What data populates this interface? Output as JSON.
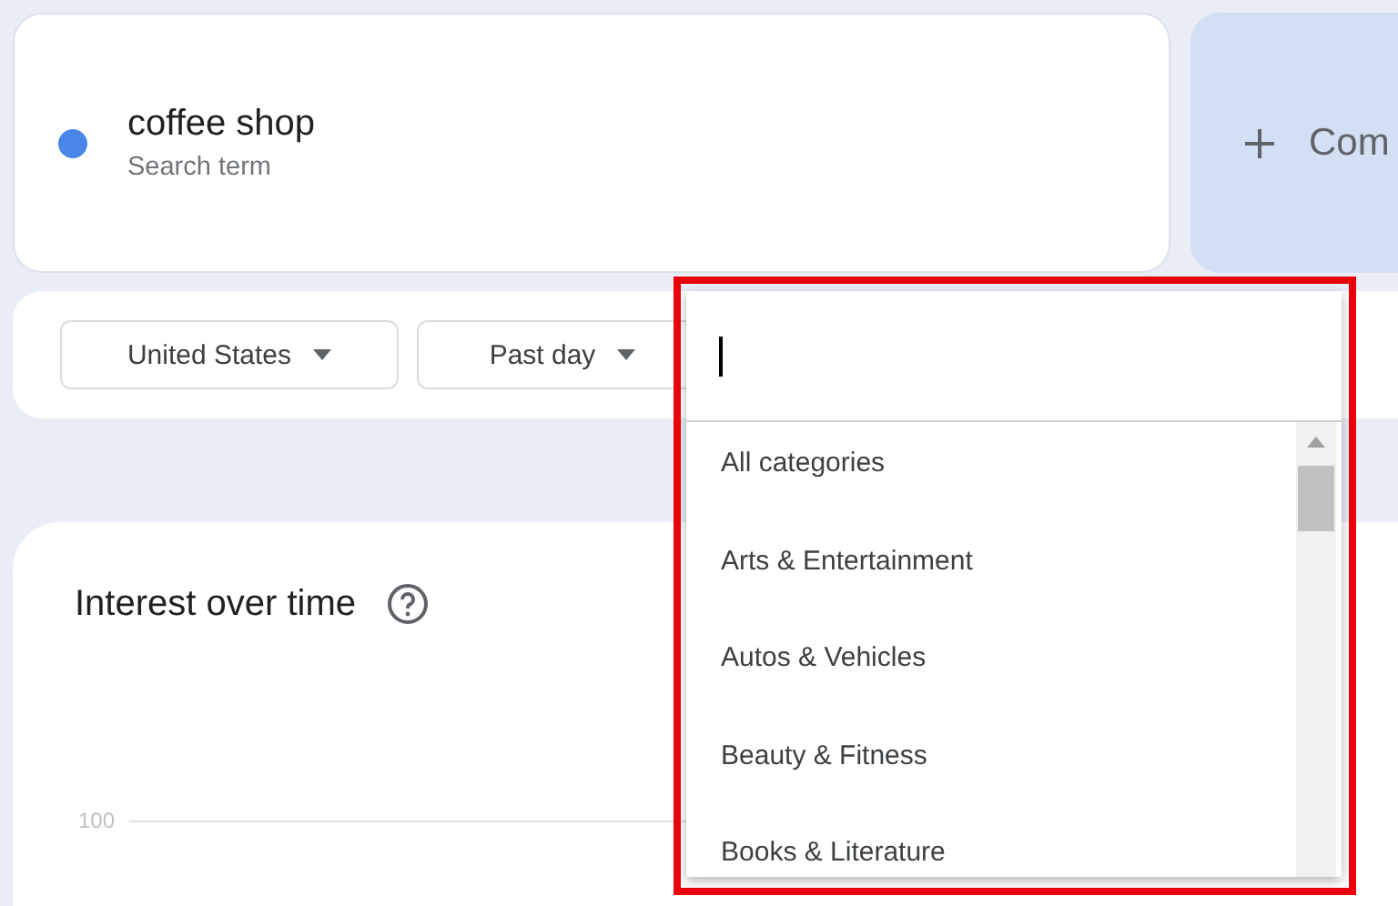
{
  "terms": [
    {
      "name": "coffee shop",
      "caption": "Search term",
      "color": "#4a86e8"
    }
  ],
  "compare_button": {
    "label": "Com"
  },
  "filters": [
    {
      "label": "United States"
    },
    {
      "label": "Past day"
    }
  ],
  "category_dropdown": {
    "items": [
      {
        "label": "All categories"
      },
      {
        "label": "Arts & Entertainment"
      },
      {
        "label": "Autos & Vehicles"
      },
      {
        "label": "Beauty & Fitness"
      },
      {
        "label": "Books & Literature"
      }
    ]
  },
  "chart": {
    "title": "Interest over time",
    "y_tick_label": "100"
  }
}
